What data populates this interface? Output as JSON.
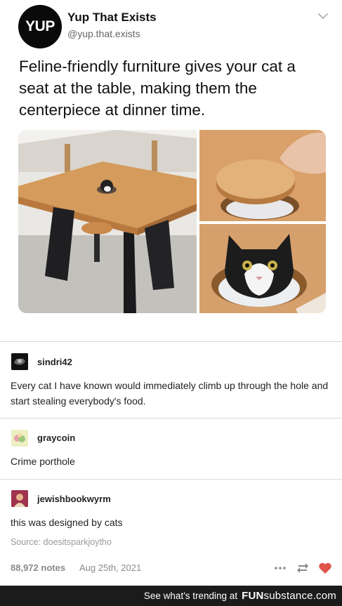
{
  "tweet": {
    "avatar_text": "YUP",
    "name": "Yup That Exists",
    "handle": "@yup.that.exists",
    "text": "Feline-friendly furniture gives your cat a seat at the table, making them the centerpiece at dinner time."
  },
  "comments": [
    {
      "username": "sindri42",
      "text": "Every cat I have known would immediately climb up through the hole and start stealing everybody's food."
    },
    {
      "username": "graycoin",
      "text": "Crime porthole"
    },
    {
      "username": "jewishbookwyrm",
      "text": "this was designed by cats"
    }
  ],
  "source": "Source: doesitsparkjoytho",
  "post_meta": {
    "notes": "88,972 notes",
    "date": "Aug 25th, 2021"
  },
  "footer": {
    "prefix": "See what's trending at",
    "brand_bold": "FUN",
    "brand_rest": "substance.com"
  },
  "colors": {
    "heart": "#e0544b",
    "footer_bg": "#1b1b1b"
  }
}
